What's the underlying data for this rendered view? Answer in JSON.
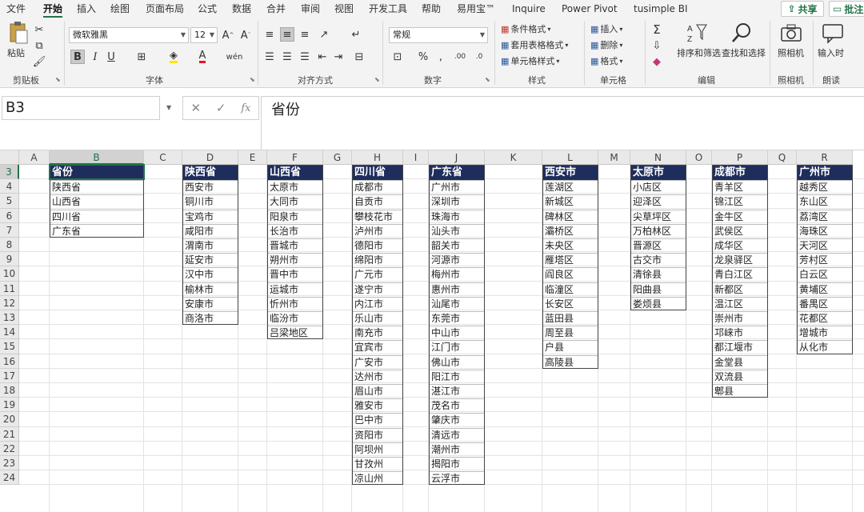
{
  "tabs": [
    "文件",
    "开始",
    "插入",
    "绘图",
    "页面布局",
    "公式",
    "数据",
    "合并",
    "审阅",
    "视图",
    "开发工具",
    "帮助",
    "易用宝™",
    "Inquire",
    "Power Pivot",
    "tusimple BI"
  ],
  "active_tab": "开始",
  "share_label": "共享",
  "comment_label": "批注",
  "ribbon": {
    "clipboard": {
      "paste": "粘贴",
      "label": "剪贴板"
    },
    "font": {
      "name": "微软雅黑",
      "size": "12",
      "label": "字体",
      "bold": "B",
      "italic": "I",
      "underline": "U"
    },
    "alignment": {
      "label": "对齐方式"
    },
    "number": {
      "format": "常规",
      "label": "数字"
    },
    "styles": {
      "conditional": "条件格式",
      "table": "套用表格格式",
      "cell": "单元格样式",
      "label": "样式"
    },
    "cells": {
      "insert": "插入",
      "delete": "删除",
      "format": "格式",
      "label": "单元格"
    },
    "editing": {
      "sort": "排序和筛选",
      "find": "查找和选择",
      "label": "编辑"
    },
    "camera": {
      "button": "照相机",
      "label": "照相机"
    },
    "read": {
      "button": "输入时",
      "label": "朗读"
    }
  },
  "formula_bar": {
    "name_box": "B3",
    "fx": "fx",
    "content": "省份"
  },
  "columns": [
    "A",
    "B",
    "C",
    "D",
    "E",
    "F",
    "G",
    "H",
    "I",
    "J",
    "K",
    "L",
    "M",
    "N",
    "O",
    "P",
    "Q",
    "R"
  ],
  "selected_column": "B",
  "rows": [
    "3",
    "4",
    "5",
    "6",
    "7",
    "8",
    "9",
    "10",
    "11",
    "12",
    "13",
    "14",
    "15",
    "16",
    "17",
    "18",
    "19",
    "20",
    "21",
    "22",
    "23",
    "24"
  ],
  "selected_row": "3",
  "tables": [
    {
      "col": "B",
      "header": "省份",
      "items": [
        "陕西省",
        "山西省",
        "四川省",
        "广东省"
      ]
    },
    {
      "col": "D",
      "header": "陕西省",
      "items": [
        "西安市",
        "铜川市",
        "宝鸡市",
        "咸阳市",
        "渭南市",
        "延安市",
        "汉中市",
        "榆林市",
        "安康市",
        "商洛市"
      ]
    },
    {
      "col": "F",
      "header": "山西省",
      "items": [
        "太原市",
        "大同市",
        "阳泉市",
        "长治市",
        "晋城市",
        "朔州市",
        "晋中市",
        "运城市",
        "忻州市",
        "临汾市",
        "吕梁地区"
      ]
    },
    {
      "col": "H",
      "header": "四川省",
      "items": [
        "成都市",
        "自贡市",
        "攀枝花市",
        "泸州市",
        "德阳市",
        "绵阳市",
        "广元市",
        "遂宁市",
        "内江市",
        "乐山市",
        "南充市",
        "宜宾市",
        "广安市",
        "达州市",
        "眉山市",
        "雅安市",
        "巴中市",
        "资阳市",
        "阿坝州",
        "甘孜州",
        "凉山州"
      ]
    },
    {
      "col": "J",
      "header": "广东省",
      "items": [
        "广州市",
        "深圳市",
        "珠海市",
        "汕头市",
        "韶关市",
        "河源市",
        "梅州市",
        "惠州市",
        "汕尾市",
        "东莞市",
        "中山市",
        "江门市",
        "佛山市",
        "阳江市",
        "湛江市",
        "茂名市",
        "肇庆市",
        "清远市",
        "潮州市",
        "揭阳市",
        "云浮市"
      ]
    },
    {
      "col": "L",
      "header": "西安市",
      "items": [
        "莲湖区",
        "新城区",
        "碑林区",
        "灞桥区",
        "未央区",
        "雁塔区",
        "阎良区",
        "临潼区",
        "长安区",
        "蓝田县",
        "周至县",
        "户县",
        "高陵县"
      ]
    },
    {
      "col": "N",
      "header": "太原市",
      "items": [
        "小店区",
        "迎泽区",
        "尖草坪区",
        "万柏林区",
        "晋源区",
        "古交市",
        "清徐县",
        "阳曲县",
        "娄烦县"
      ]
    },
    {
      "col": "P",
      "header": "成都市",
      "items": [
        "青羊区",
        "锦江区",
        "金牛区",
        "武侯区",
        "成华区",
        "龙泉驿区",
        "青白江区",
        "新都区",
        "温江区",
        "崇州市",
        "邛崃市",
        "都江堰市",
        "金堂县",
        "双流县",
        "郫县"
      ]
    },
    {
      "col": "R",
      "header": "广州市",
      "items": [
        "越秀区",
        "东山区",
        "荔湾区",
        "海珠区",
        "天河区",
        "芳村区",
        "白云区",
        "黄埔区",
        "番禺区",
        "花都区",
        "增城市",
        "从化市"
      ]
    }
  ]
}
